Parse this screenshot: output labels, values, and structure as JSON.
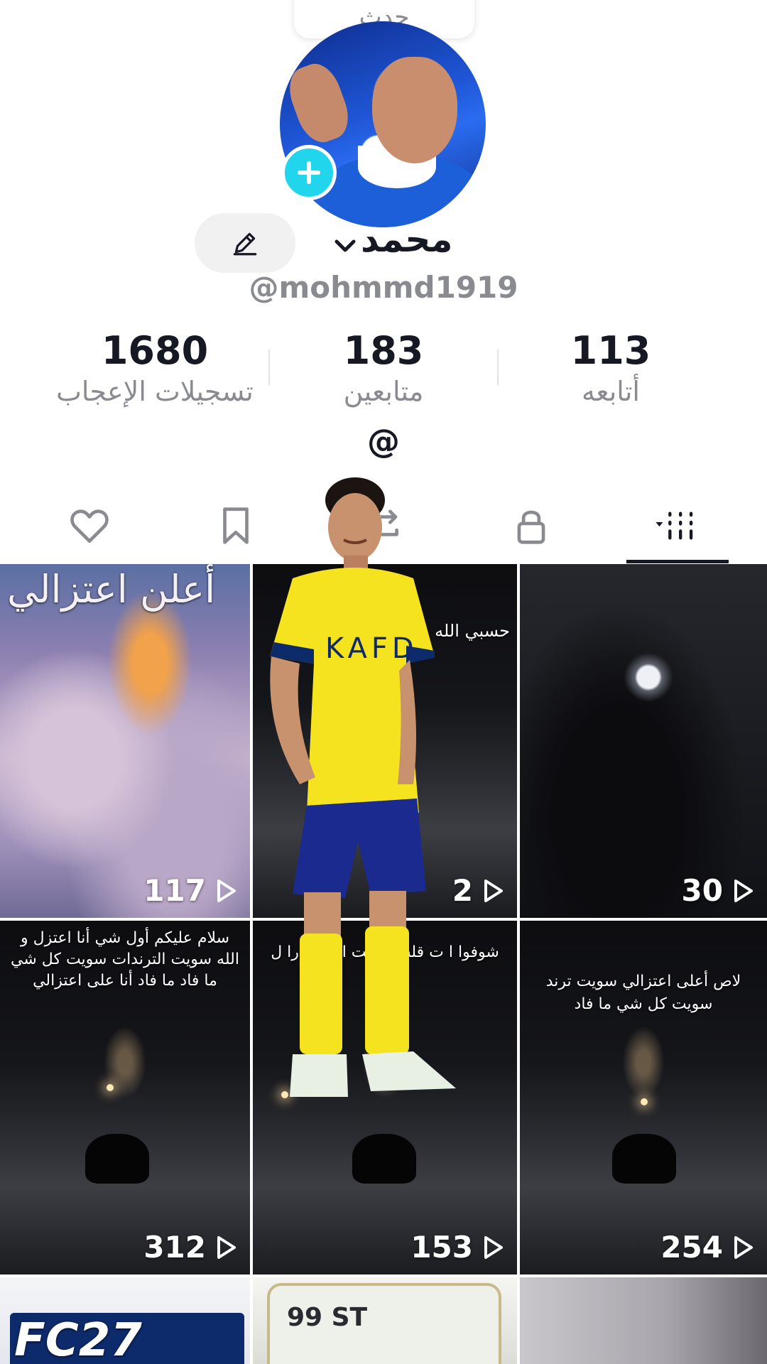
{
  "profile": {
    "tooltip": "حدث",
    "name": "محمد",
    "handle": "@mohmmd1919",
    "bio": "@"
  },
  "stats": [
    {
      "value": "1680",
      "label": "تسجيلات الإعجاب"
    },
    {
      "value": "183",
      "label": "متابعين"
    },
    {
      "value": "113",
      "label": "أتابعه"
    }
  ],
  "tabs": [
    "liked",
    "favorites",
    "reposts",
    "private",
    "videos"
  ],
  "videos": [
    {
      "caption": "أعلن اعتزالي",
      "views": "117"
    },
    {
      "caption": "حسبي الله ع",
      "views": "2"
    },
    {
      "caption": "",
      "views": "30"
    },
    {
      "caption": "سلام عليكم أول شي أنا اعتزل و الله سويت الترندات سويت كل شي ما فاد ما فاد أنا على اعتزالي",
      "views": "312"
    },
    {
      "caption": "شوفوا ا ت قلب وكتبت الت ما را ل",
      "views": "153"
    },
    {
      "caption": "لاص أعلى اعتزالي سويت ترند سويت كل شي ما فاد",
      "views": "254"
    },
    {
      "caption": "FC27",
      "views": ""
    },
    {
      "caption": "99 ST",
      "views": ""
    },
    {
      "caption": "",
      "views": ""
    }
  ],
  "overlay": {
    "jersey_text": "KAFD"
  },
  "colors": {
    "accent": "#20d5ec",
    "text": "#161823",
    "muted": "#8a8b91"
  }
}
